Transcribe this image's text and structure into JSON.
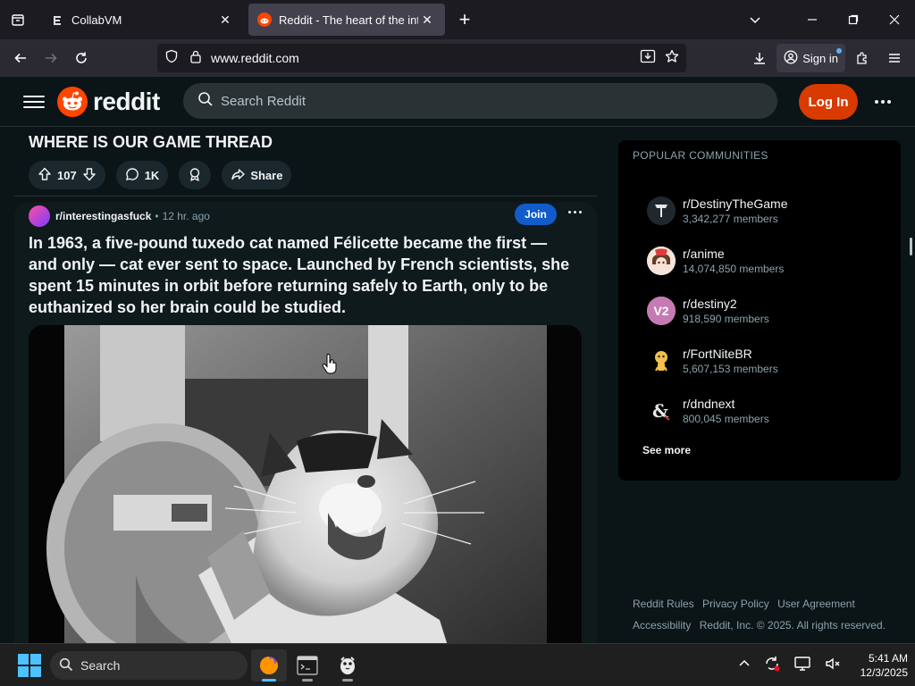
{
  "browser": {
    "tabs": [
      {
        "title": "CollabVM",
        "active": false,
        "favicon": "collabvm-icon"
      },
      {
        "title": "Reddit - The heart of the internet",
        "active": true,
        "favicon": "reddit-icon"
      }
    ],
    "url": "www.reddit.com",
    "sign_in_label": "Sign in"
  },
  "reddit": {
    "logo_text": "reddit",
    "search_placeholder": "Search Reddit",
    "login_label": "Log In",
    "brand_color": "#ff4500"
  },
  "feed": {
    "previous_post": {
      "title": "WHERE IS OUR GAME THREAD",
      "votes": "107",
      "comments": "1K",
      "share_label": "Share"
    },
    "post": {
      "subreddit": "r/interestingasfuck",
      "separator": "•",
      "time": "12 hr. ago",
      "join_label": "Join",
      "title": "In 1963, a five-pound tuxedo cat named Félicette became the first — and only — cat ever sent to space. Launched by French scientists, she spent 15 minutes in orbit before returning safely to Earth, only to be euthanized so her brain could be studied."
    }
  },
  "sidebar": {
    "heading": "POPULAR COMMUNITIES",
    "communities": [
      {
        "name": "r/DestinyTheGame",
        "members": "3,342,277 members"
      },
      {
        "name": "r/anime",
        "members": "14,074,850 members"
      },
      {
        "name": "r/destiny2",
        "members": "918,590 members"
      },
      {
        "name": "r/FortNiteBR",
        "members": "5,607,153 members"
      },
      {
        "name": "r/dndnext",
        "members": "800,045 members"
      }
    ],
    "see_more_label": "See more"
  },
  "footer": {
    "links": [
      "Reddit Rules",
      "Privacy Policy",
      "User Agreement",
      "Accessibility"
    ],
    "copyright": "Reddit, Inc. © 2025. All rights reserved."
  },
  "taskbar": {
    "search_label": "Search",
    "time": "5:41 AM",
    "date": "12/3/2025"
  }
}
